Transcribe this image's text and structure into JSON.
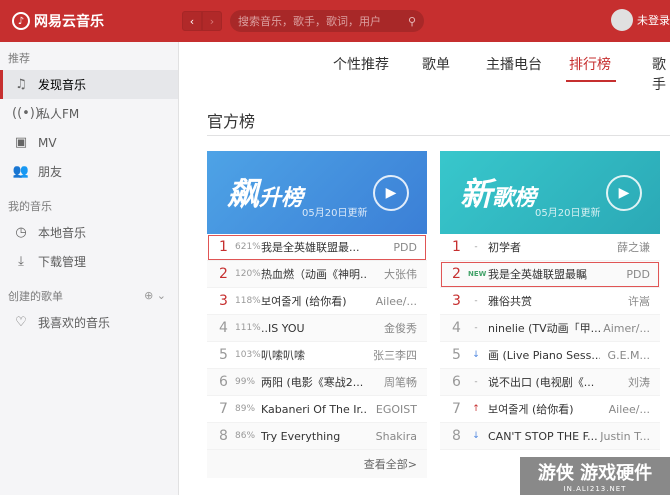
{
  "app": {
    "title": "网易云音乐",
    "user_label": "未登录"
  },
  "search": {
    "placeholder": "搜索音乐，歌手，歌词，用户"
  },
  "sidebar": {
    "recommend_title": "推荐",
    "items": [
      {
        "label": "发现音乐",
        "icon": "music-note-icon"
      },
      {
        "label": "私人FM",
        "icon": "radio-icon"
      },
      {
        "label": "MV",
        "icon": "video-icon"
      },
      {
        "label": "朋友",
        "icon": "friends-icon"
      }
    ],
    "my_music_title": "我的音乐",
    "my_items": [
      {
        "label": "本地音乐",
        "icon": "clock-icon"
      },
      {
        "label": "下载管理",
        "icon": "download-icon"
      }
    ],
    "created_title": "创建的歌单",
    "created_items": [
      {
        "label": "我喜欢的音乐",
        "icon": "heart-icon"
      }
    ]
  },
  "tabs": [
    "个性推荐",
    "歌单",
    "主播电台",
    "排行榜",
    "歌手"
  ],
  "main": {
    "heading": "官方榜"
  },
  "board1": {
    "title_big": "飙",
    "title_small": "升榜",
    "date": "05月20日更新",
    "rows": [
      {
        "rank": "1",
        "pct": "621%",
        "title": "我是全英雄联盟最...",
        "artist": "PDD"
      },
      {
        "rank": "2",
        "pct": "120%",
        "title": "热血燃（动画《神明...",
        "artist": "大张伟"
      },
      {
        "rank": "3",
        "pct": "118%",
        "title": "보여줄게 (给你看)",
        "artist": "Ailee/..."
      },
      {
        "rank": "4",
        "pct": "111%",
        "title": "..IS YOU",
        "artist": "金俊秀"
      },
      {
        "rank": "5",
        "pct": "103%",
        "title": "叭嗦叭嗦",
        "artist": "张三李四"
      },
      {
        "rank": "6",
        "pct": "99%",
        "title": "两阳 (电影《寒战2...",
        "artist": "周笔畅"
      },
      {
        "rank": "7",
        "pct": "89%",
        "title": "Kabaneri Of The Ir...",
        "artist": "EGOIST"
      },
      {
        "rank": "8",
        "pct": "86%",
        "title": "Try Everything",
        "artist": "Shakira"
      }
    ],
    "more": "查看全部>"
  },
  "board2": {
    "title_big": "新",
    "title_small": "歌榜",
    "date": "05月20日更新",
    "rows": [
      {
        "rank": "1",
        "mark": "-",
        "title": "初学者",
        "artist": "薛之谦"
      },
      {
        "rank": "2",
        "mark": "NEW",
        "title": "我是全英雄联盟最瞩",
        "artist": "PDD"
      },
      {
        "rank": "3",
        "mark": "-",
        "title": "雅俗共赏",
        "artist": "许嵩"
      },
      {
        "rank": "4",
        "mark": "-",
        "title": "ninelie (TV动画「甲...",
        "artist": "Aimer/..."
      },
      {
        "rank": "5",
        "mark": "↓",
        "title": "画 (Live Piano Sess...",
        "artist": "G.E.M..."
      },
      {
        "rank": "6",
        "mark": "-",
        "title": "说不出口 (电视剧《...",
        "artist": "刘涛"
      },
      {
        "rank": "7",
        "mark": "↑",
        "title": "보여줄게 (给你看)",
        "artist": "Ailee/..."
      },
      {
        "rank": "8",
        "mark": "↓",
        "title": "CAN'T STOP THE F...",
        "artist": "Justin T..."
      }
    ]
  },
  "watermark": {
    "main": "游侠 游戏硬件",
    "sub": "IN.ALI213.NET"
  }
}
